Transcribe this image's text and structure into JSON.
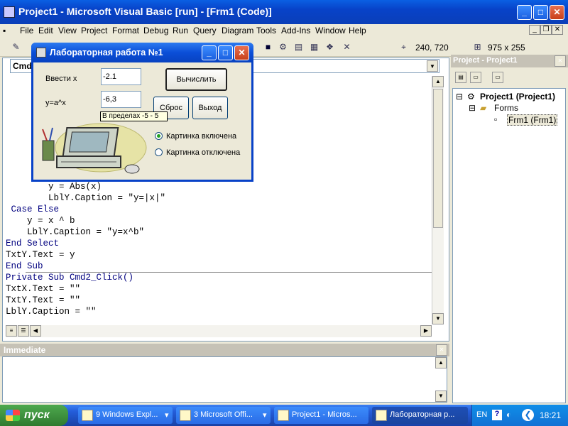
{
  "window": {
    "title": "Project1 - Microsoft Visual Basic [run] - [Frm1 (Code)]"
  },
  "menu": [
    "File",
    "Edit",
    "View",
    "Project",
    "Format",
    "Debug",
    "Run",
    "Query",
    "Diagram",
    "Tools",
    "Add-Ins",
    "Window",
    "Help"
  ],
  "toolbar": {
    "position": "240, 720",
    "size": "975 x 255"
  },
  "code_window": {
    "object_combo": "Cmd",
    "lines": [
      "        y = Abs(x)",
      "        LblY.Caption = \"y=|x|\"",
      " Case Else",
      "    y = x ^ b",
      "    LblY.Caption = \"y=x^b\"",
      "End Select",
      "TxtY.Text = y",
      "End Sub",
      "Private Sub Cmd2_Click()",
      "TxtX.Text = \"\"",
      "TxtY.Text = \"\"",
      "LblY.Caption = \"\""
    ]
  },
  "immediate": {
    "title": "Immediate"
  },
  "project_panel": {
    "title": "Project - Project1",
    "tree": [
      {
        "label": "Project1 (Project1)"
      },
      {
        "label": "Forms"
      },
      {
        "label": "Frm1 (Frm1)"
      }
    ]
  },
  "dialog": {
    "title": "Лабораторная работа №1",
    "label_x": "Ввести x",
    "value_x": "-2.1",
    "label_y": "y=a^x",
    "value_y": "-6,3",
    "btn_calc": "Вычислить",
    "btn_reset": "Сброс",
    "btn_exit": "Выход",
    "tooltip": "В пределах  -5 - 5",
    "radio_on": "Картинка включена",
    "radio_off": "Картинка отключена"
  },
  "taskbar": {
    "start": "пуск",
    "tasks": [
      {
        "label": "9 Windows Expl..."
      },
      {
        "label": "3 Microsoft Offi..."
      },
      {
        "label": "Project1 - Micros..."
      },
      {
        "label": "Лабораторная р..."
      }
    ],
    "lang": "EN",
    "time": "18:21"
  }
}
